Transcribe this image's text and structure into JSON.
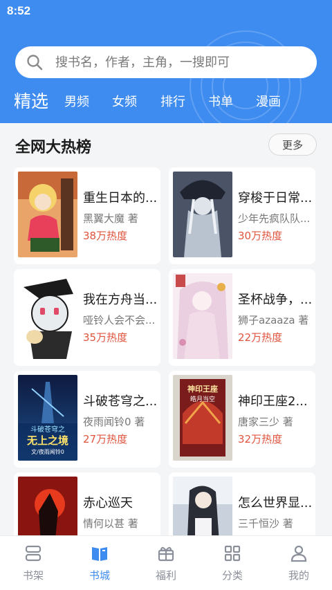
{
  "status_bar": {
    "time": "8:52"
  },
  "search": {
    "placeholder": "搜书名，作者，主角，一搜即可"
  },
  "tabs": [
    {
      "label": "精选",
      "active": true
    },
    {
      "label": "男频"
    },
    {
      "label": "女频"
    },
    {
      "label": "排行"
    },
    {
      "label": "书单"
    },
    {
      "label": "漫画"
    }
  ],
  "section": {
    "title": "全网大热榜",
    "more_label": "更多"
  },
  "books": [
    {
      "title": "重生日本的...",
      "author": "黑翼大魔 著",
      "heat": "38万热度"
    },
    {
      "title": "穿梭于日常...",
      "author": "少年先疯队队...",
      "heat": "30万热度"
    },
    {
      "title": "我在方舟当...",
      "author": "哑铃人会不会...",
      "heat": "35万热度"
    },
    {
      "title": "圣杯战争，...",
      "author": "狮子azaaza 著",
      "heat": "22万热度"
    },
    {
      "title": "斗破苍穹之...",
      "author": "夜雨闻铃0 著",
      "heat": "27万热度"
    },
    {
      "title": "神印王座2...",
      "author": "唐家三少 著",
      "heat": "32万热度"
    },
    {
      "title": "赤心巡天",
      "author": "情何以甚 著",
      "heat": ""
    },
    {
      "title": "怎么世界显...",
      "author": "三千恒沙 著",
      "heat": ""
    }
  ],
  "covers": [
    {
      "text": ""
    },
    {
      "text": ""
    },
    {
      "text": ""
    },
    {
      "text": ""
    },
    {
      "text": "斗破苍穹之",
      "text2": "无上之境",
      "text3": "文/夜雨闻铃0"
    },
    {
      "text": "神印王座",
      "text2": "皓月当空"
    },
    {
      "text": ""
    },
    {
      "text": ""
    }
  ],
  "bottom_nav": [
    {
      "label": "书架",
      "icon": "bookshelf-icon"
    },
    {
      "label": "书城",
      "icon": "book-open-icon",
      "active": true
    },
    {
      "label": "福利",
      "icon": "gift-icon"
    },
    {
      "label": "分类",
      "icon": "grid-icon"
    },
    {
      "label": "我的",
      "icon": "user-icon"
    }
  ],
  "colors": {
    "primary": "#3f8cf0",
    "heat": "#e0533d",
    "background": "#f4f5f7"
  }
}
